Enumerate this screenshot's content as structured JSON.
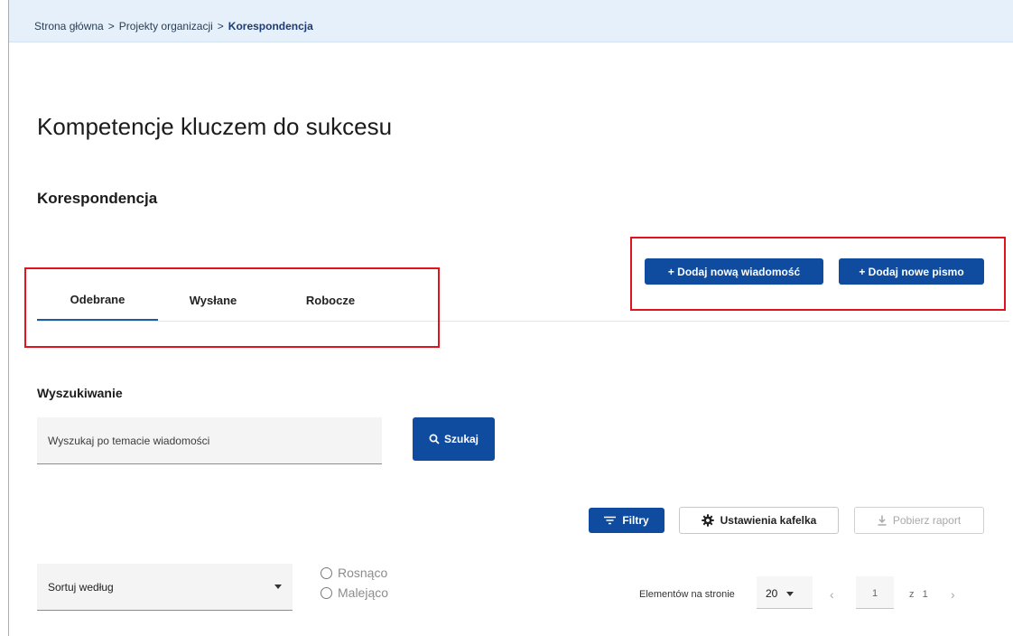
{
  "breadcrumb": {
    "home": "Strona główna",
    "projects": "Projekty organizacji",
    "current": "Korespondencja",
    "separator": ">"
  },
  "page": {
    "title": "Kompetencje kluczem do sukcesu",
    "section": "Korespondencja"
  },
  "actions": {
    "new_message": "+ Dodaj nową wiadomość",
    "new_letter": "+ Dodaj nowe pismo"
  },
  "tabs": [
    {
      "label": "Odebrane",
      "active": true
    },
    {
      "label": "Wysłane",
      "active": false
    },
    {
      "label": "Robocze",
      "active": false
    }
  ],
  "search": {
    "label": "Wyszukiwanie",
    "placeholder": "Wyszukaj po temacie wiadomości",
    "button": "Szukaj"
  },
  "toolbar": {
    "filters": "Filtry",
    "tile_settings": "Ustawienia kafelka",
    "download_report": "Pobierz raport"
  },
  "sort": {
    "label": "Sortuj według",
    "ascending": "Rosnąco",
    "descending": "Malejąco"
  },
  "pagination": {
    "per_page_label": "Elementów na stronie",
    "per_page_value": "20",
    "current_page": "1",
    "of_label": "z",
    "total_pages": "1"
  },
  "colors": {
    "primary": "#0f4c9f",
    "breadcrumb_bg": "#e5f0fa",
    "highlight": "#e0141e"
  }
}
